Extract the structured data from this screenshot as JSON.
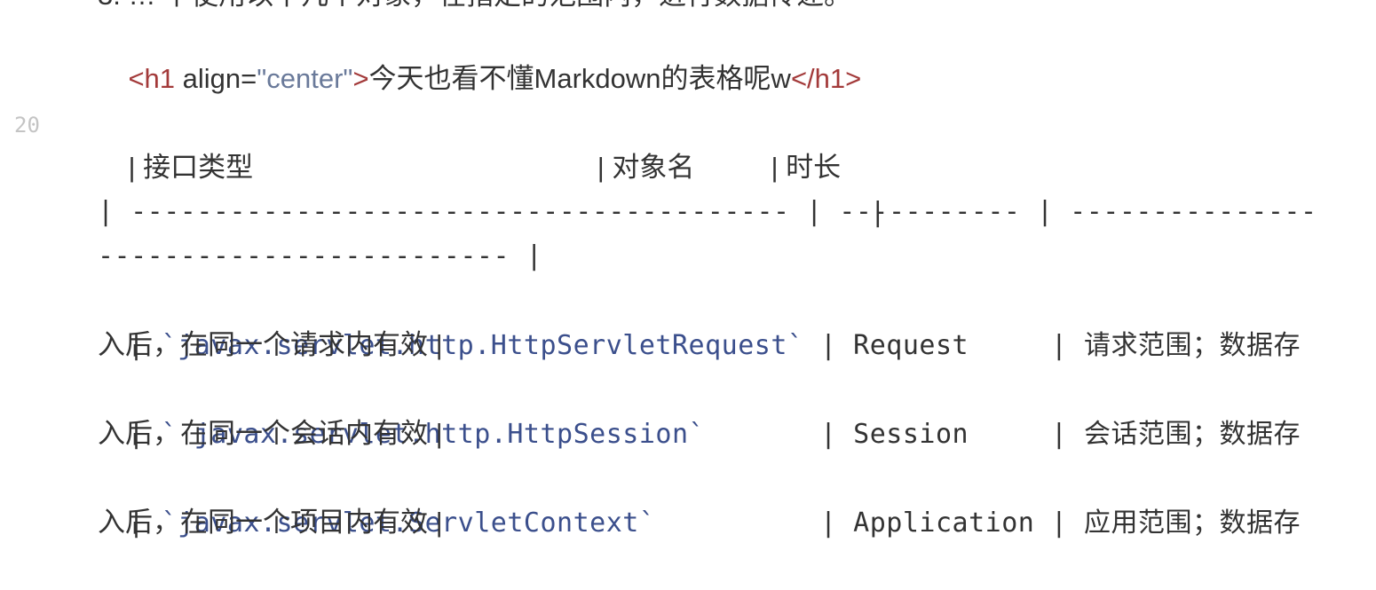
{
  "editor": {
    "line_number": "20",
    "cut_off_line": "3. … 下使用以下几个对象，在指定的范围内，进行数据传递。",
    "h1_line": {
      "open_tag": "<h1",
      "attr_name": " align=",
      "attr_value": "\"center\"",
      "close_bracket": ">",
      "content": "今天也看不懂Markdown的表格呢w",
      "end_tag": "</h1>"
    },
    "table": {
      "header_row": "| 接口类型                                             | 对象名          | 时长",
      "header_wrap": "                                             |",
      "separator_row": "| ---------------------------------------- | ----------- | ---------------",
      "separator_wrap": "------------------------- |",
      "rows": [
        {
          "lead": "| ",
          "code": "`javax.servlet.http.HttpServletRequest`",
          "mid": " | Request     | 请求范围；数据存",
          "wrap": "入后，在同一个请求内有效 |"
        },
        {
          "lead": "| ",
          "code": "` javax.servlet.http.HttpSession`",
          "mid": "       | Session     | 会话范围；数据存",
          "wrap": "入后，在同一个会话内有效 |"
        },
        {
          "lead": "| ",
          "code": "`javax.servlet.ServletContext`",
          "mid": "          | Application | 应用范围；数据存",
          "wrap": "入后，在同一个项目内有效 |"
        }
      ]
    }
  }
}
